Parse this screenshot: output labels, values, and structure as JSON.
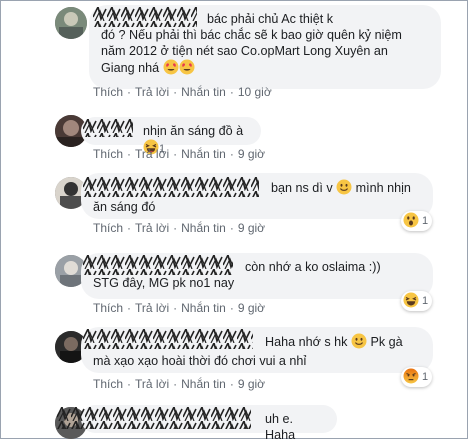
{
  "comments": [
    {
      "text_lines": [
        "bác phải chủ Ac thiệt k",
        "đó ? Nếu phải thì bác chắc sẽ k bao giờ quên kỷ niệm",
        "năm 2012 ở tiện nét sao Co.opMart Long Xuyên an",
        "Giang nhá"
      ],
      "like": "Thích",
      "reply": "Trả lời",
      "message": "Nhắn tin",
      "time": "10 giờ"
    },
    {
      "text_lines": [
        "nhịn ăn sáng đồ à"
      ],
      "reaction_count": "1",
      "like": "Thích",
      "reply": "Trả lời",
      "message": "Nhắn tin",
      "time": "9 giờ"
    },
    {
      "text_lines": [
        "bạn ns dì v",
        "mình nhịn",
        "ăn sáng đó"
      ],
      "reaction_count": "1",
      "like": "Thích",
      "reply": "Trả lời",
      "message": "Nhắn tin",
      "time": "9 giờ"
    },
    {
      "text_lines": [
        "còn nhớ a ko oslaima :))",
        "STG đây, MG pk no1 nay"
      ],
      "reaction_count": "1",
      "like": "Thích",
      "reply": "Trả lời",
      "message": "Nhắn tin",
      "time": "9 giờ"
    },
    {
      "text_lines": [
        "Haha nhớ s hk",
        "Pk gà",
        "mà xạo xạo hoài thời đó chơi vui a nhỉ"
      ],
      "reaction_count": "1",
      "like": "Thích",
      "reply": "Trả lời",
      "message": "Nhắn tin",
      "time": "9 giờ"
    },
    {
      "text_lines": [
        "uh e. Haha"
      ]
    }
  ],
  "icons": {
    "heart_eyes": "heart-eyes-emoji",
    "laughing": "laughing-emoji",
    "smile": "smile-emoji",
    "wow": "wow-emoji",
    "angry": "angry-emoji"
  },
  "colors": {
    "bubble": "#f2f3f5",
    "meta_text": "#606770",
    "angry": "#e9710f",
    "emoji_yellow": "#f7c544"
  }
}
